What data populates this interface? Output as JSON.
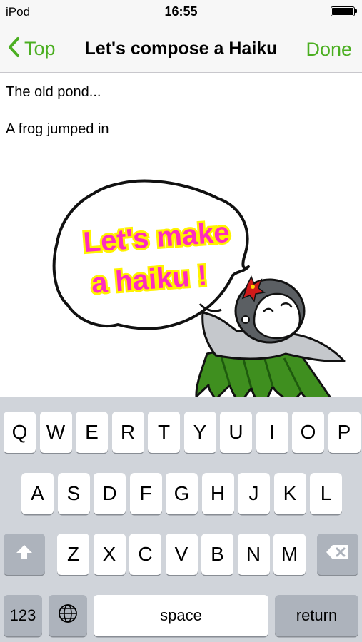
{
  "status_bar": {
    "carrier": "iPod",
    "time": "16:55",
    "battery_level": 1.0
  },
  "nav": {
    "back_label": "Top",
    "title": "Let's compose a Haiku",
    "done_label": "Done",
    "accent_color": "#4caf22"
  },
  "editor": {
    "lines": [
      "The old pond...",
      "A frog jumped in"
    ]
  },
  "illustration": {
    "speech_line1": "Let's make",
    "speech_line2": "a haiku !",
    "speech_color": "#ff2bbd",
    "speech_glow": "#fff200"
  },
  "keyboard": {
    "row1": [
      "Q",
      "W",
      "E",
      "R",
      "T",
      "Y",
      "U",
      "I",
      "O",
      "P"
    ],
    "row2": [
      "A",
      "S",
      "D",
      "F",
      "G",
      "H",
      "J",
      "K",
      "L"
    ],
    "row3": [
      "Z",
      "X",
      "C",
      "V",
      "B",
      "N",
      "M"
    ],
    "numbers_label": "123",
    "space_label": "space",
    "return_label": "return",
    "shift_icon": "shift-arrow-icon",
    "delete_icon": "delete-icon",
    "globe_icon": "globe-icon"
  }
}
